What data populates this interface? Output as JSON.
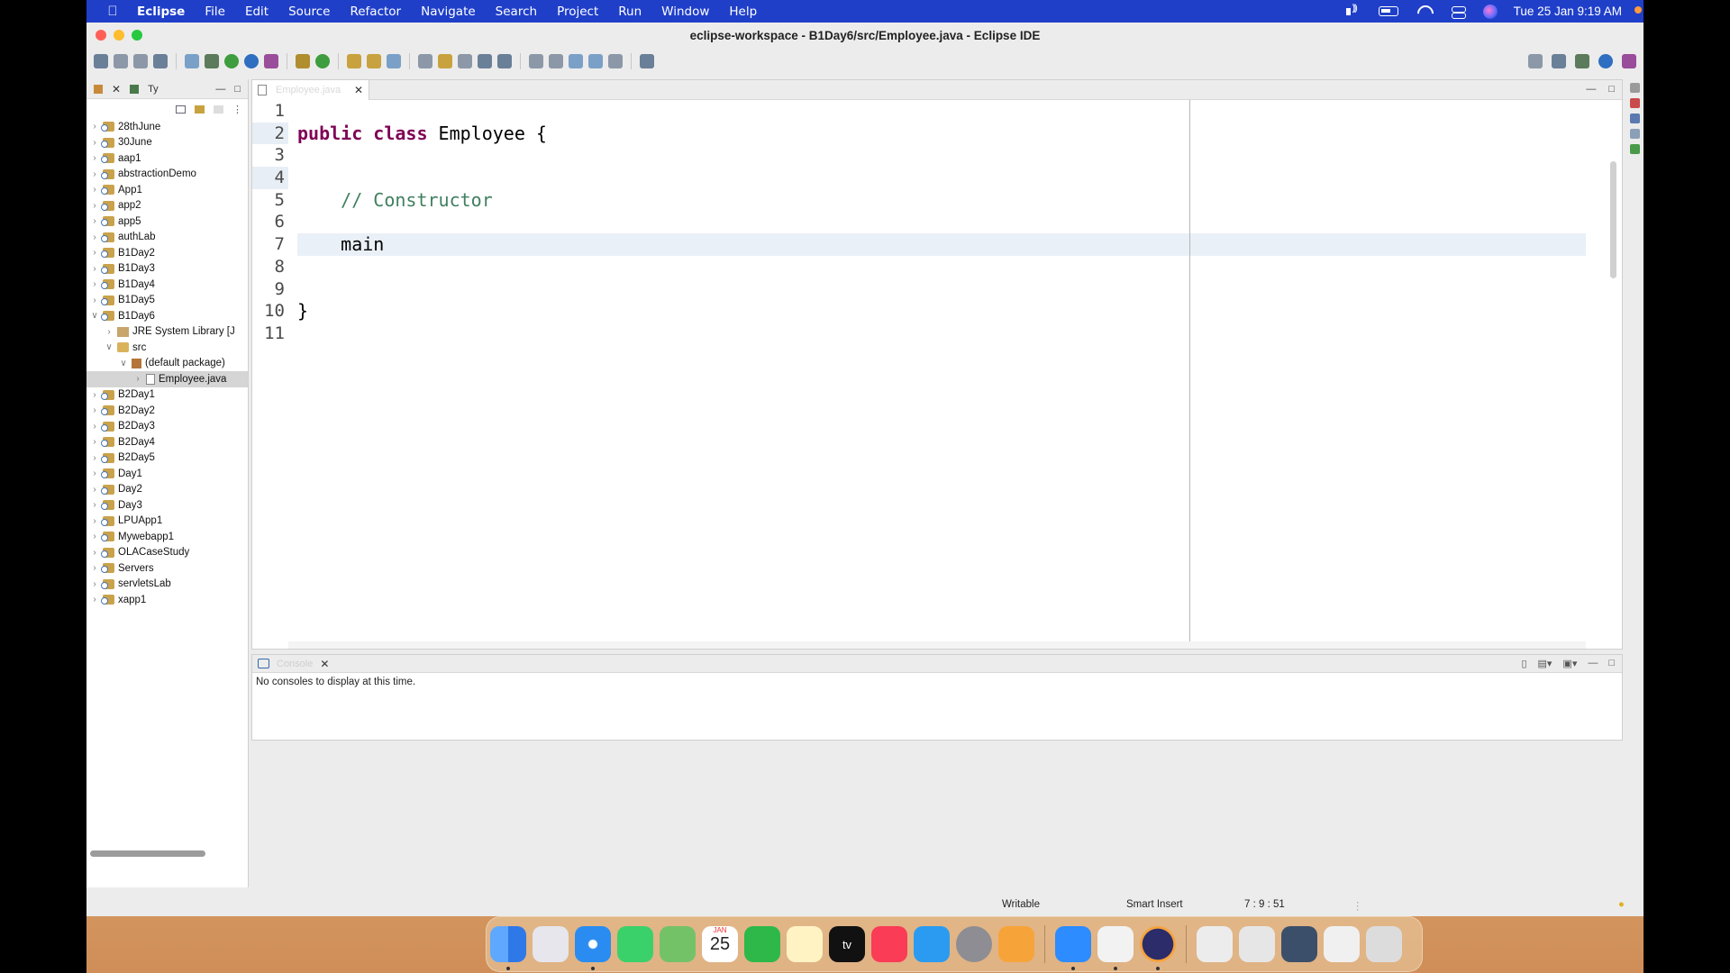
{
  "menubar": {
    "app_name": "Eclipse",
    "menus": [
      "File",
      "Edit",
      "Source",
      "Refactor",
      "Navigate",
      "Search",
      "Project",
      "Run",
      "Window",
      "Help"
    ],
    "clock": "Tue 25 Jan  9:19 AM"
  },
  "window": {
    "title": "eclipse-workspace - B1Day6/src/Employee.java - Eclipse IDE"
  },
  "explorer": {
    "tab_label": "Ty",
    "items": [
      {
        "label": "28thJune",
        "level": 0,
        "expanded": false
      },
      {
        "label": "30June",
        "level": 0,
        "expanded": false
      },
      {
        "label": "aap1",
        "level": 0,
        "expanded": false
      },
      {
        "label": "abstractionDemo",
        "level": 0,
        "expanded": false
      },
      {
        "label": "App1",
        "level": 0,
        "expanded": false
      },
      {
        "label": "app2",
        "level": 0,
        "expanded": false
      },
      {
        "label": "app5",
        "level": 0,
        "expanded": false
      },
      {
        "label": "authLab",
        "level": 0,
        "expanded": false
      },
      {
        "label": "B1Day2",
        "level": 0,
        "expanded": false
      },
      {
        "label": "B1Day3",
        "level": 0,
        "expanded": false
      },
      {
        "label": "B1Day4",
        "level": 0,
        "expanded": false
      },
      {
        "label": "B1Day5",
        "level": 0,
        "expanded": false
      },
      {
        "label": "B1Day6",
        "level": 0,
        "expanded": true
      },
      {
        "label": "JRE System Library [J",
        "level": 1,
        "expanded": false
      },
      {
        "label": "src",
        "level": 1,
        "expanded": true
      },
      {
        "label": "(default package)",
        "level": 2,
        "expanded": true
      },
      {
        "label": "Employee.java",
        "level": 3,
        "expanded": false,
        "selected": true
      },
      {
        "label": "B2Day1",
        "level": 0,
        "expanded": false
      },
      {
        "label": "B2Day2",
        "level": 0,
        "expanded": false
      },
      {
        "label": "B2Day3",
        "level": 0,
        "expanded": false
      },
      {
        "label": "B2Day4",
        "level": 0,
        "expanded": false
      },
      {
        "label": "B2Day5",
        "level": 0,
        "expanded": false
      },
      {
        "label": "Day1",
        "level": 0,
        "expanded": false
      },
      {
        "label": "Day2",
        "level": 0,
        "expanded": false
      },
      {
        "label": "Day3",
        "level": 0,
        "expanded": false
      },
      {
        "label": "LPUApp1",
        "level": 0,
        "expanded": false
      },
      {
        "label": "Mywebapp1",
        "level": 0,
        "expanded": false
      },
      {
        "label": "OLACaseStudy",
        "level": 0,
        "expanded": false
      },
      {
        "label": "Servers",
        "level": 0,
        "expanded": false
      },
      {
        "label": "servletsLab",
        "level": 0,
        "expanded": false
      },
      {
        "label": "xapp1",
        "level": 0,
        "expanded": false
      }
    ]
  },
  "editor": {
    "tab_label": "Employee.java",
    "line_numbers": [
      "1",
      "2",
      "3",
      "4",
      "5",
      "6",
      "7",
      "8",
      "9",
      "10",
      "11"
    ],
    "code": {
      "l2_kw1": "public",
      "l2_kw2": "class",
      "l2_rest": " Employee {",
      "l5_comment": "// Constructor",
      "l7_text": "main",
      "l10_text": "}"
    }
  },
  "console": {
    "tab_label": "Console",
    "message": "No consoles to display at this time."
  },
  "statusbar": {
    "mode": "Writable",
    "insert": "Smart Insert",
    "position": "7 : 9 : 51"
  },
  "dock": {
    "calendar_month": "JAN",
    "calendar_day": "25",
    "tv_label": "tv"
  }
}
